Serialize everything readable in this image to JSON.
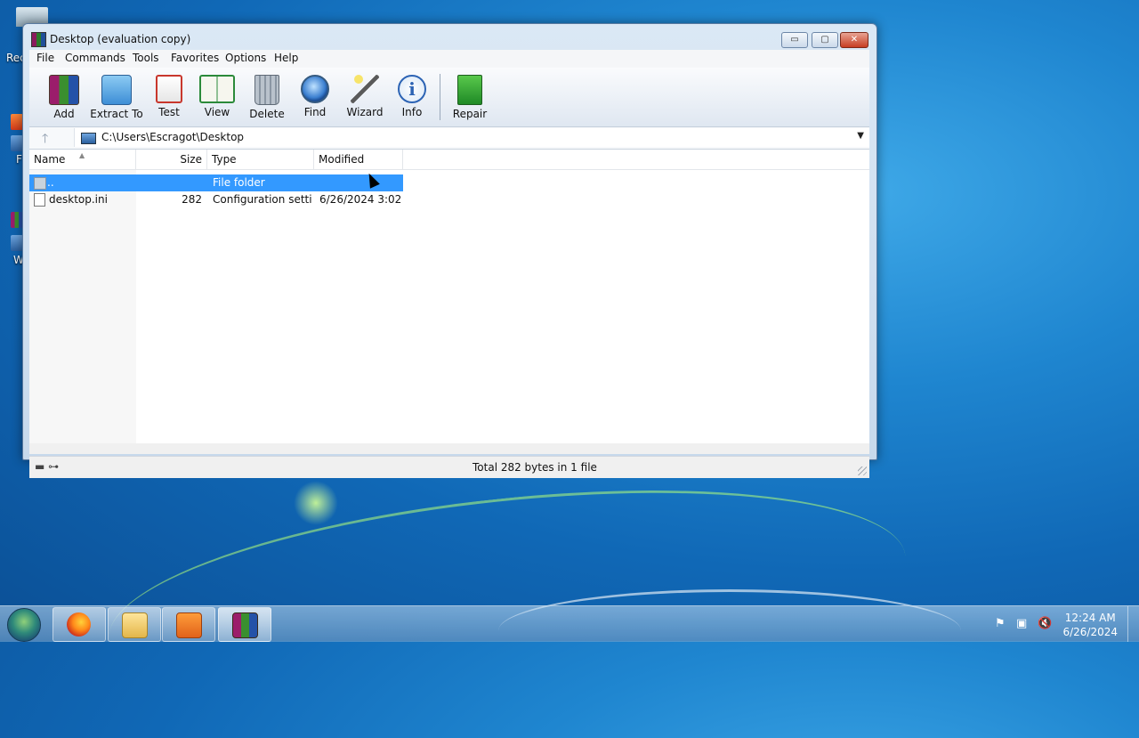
{
  "desktop": {
    "fragments": [
      "Rec",
      "F",
      "W"
    ]
  },
  "window": {
    "title": "Desktop (evaluation copy)",
    "controls": {
      "minimize": "▭",
      "maximize": "▢",
      "close": "✕"
    }
  },
  "menu": [
    "File",
    "Commands",
    "Tools",
    "Favorites",
    "Options",
    "Help"
  ],
  "toolbar": {
    "buttons": [
      {
        "label": "Add",
        "icon": "add-archive-icon"
      },
      {
        "label": "Extract To",
        "icon": "extract-folder-icon"
      },
      {
        "label": "Test",
        "icon": "test-clipboard-icon"
      },
      {
        "label": "View",
        "icon": "view-book-icon"
      },
      {
        "label": "Delete",
        "icon": "trash-can-icon"
      },
      {
        "label": "Find",
        "icon": "magnifier-icon"
      },
      {
        "label": "Wizard",
        "icon": "magic-wand-icon"
      },
      {
        "label": "Info",
        "icon": "info-icon"
      },
      {
        "label": "Repair",
        "icon": "repair-kit-icon"
      }
    ]
  },
  "address": {
    "path": "C:\\Users\\Escragot\\Desktop",
    "up_glyph": "🡑",
    "drop_glyph": "▼"
  },
  "columns": [
    "Name",
    "Size",
    "Type",
    "Modified"
  ],
  "rows": [
    {
      "name": "..",
      "size": "",
      "type": "File folder",
      "modified": "",
      "selected": true
    },
    {
      "name": "desktop.ini",
      "size": "282",
      "type": "Configuration setti...",
      "modified": "6/26/2024 3:02 ...",
      "selected": false
    }
  ],
  "status": {
    "text": "Total 282 bytes in 1 file",
    "icons": "▬ ⊶"
  },
  "taskbar": {
    "apps": [
      "firefox-icon",
      "file-explorer-icon",
      "media-player-icon",
      "winrar-icon"
    ],
    "active_app": "winrar-icon"
  },
  "tray": {
    "flag": "⚑",
    "network": "▣",
    "volume": "🔇",
    "time": "12:24 AM",
    "date": "6/26/2024"
  },
  "colors": {
    "selection": "#3399ff",
    "close_button": "#c73d22"
  }
}
